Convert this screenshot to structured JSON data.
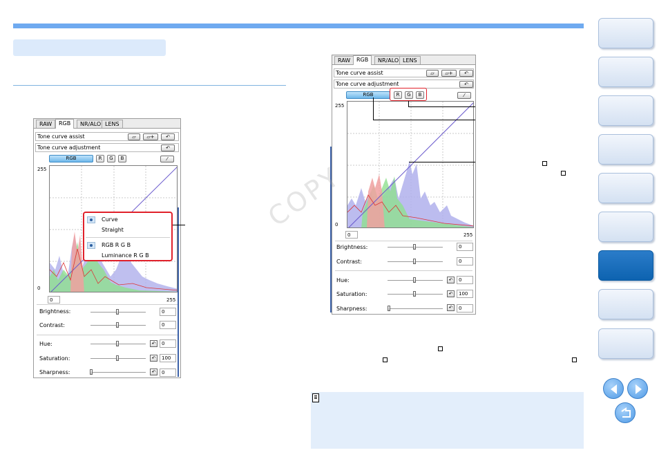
{
  "watermark": "COPY",
  "left_panel": {
    "tabs": [
      "RAW",
      "RGB",
      "NR/ALO",
      "LENS"
    ],
    "tone_curve_assist": "Tone curve assist",
    "tone_curve_adjustment": "Tone curve adjustment",
    "channels": [
      "RGB",
      "R",
      "G",
      "B"
    ],
    "axis_max": "255",
    "axis_min": "0",
    "input_min": "0",
    "input_max": "255",
    "sliders": [
      {
        "label": "Brightness:",
        "value": "0"
      },
      {
        "label": "Contrast:",
        "value": "0"
      },
      {
        "label": "Hue:",
        "value": "0"
      },
      {
        "label": "Saturation:",
        "value": "100"
      },
      {
        "label": "Sharpness:",
        "value": "0"
      }
    ],
    "menu": {
      "curve": "Curve",
      "straight": "Straight",
      "rgb": "RGB R G B",
      "luminance": "Luminance R G B"
    }
  },
  "right_panel": {
    "tabs": [
      "RAW",
      "RGB",
      "NR/ALO",
      "LENS"
    ],
    "tone_curve_assist": "Tone curve assist",
    "tone_curve_adjustment": "Tone curve adjustment",
    "channels": [
      "RGB",
      "R",
      "G",
      "B"
    ],
    "axis_max": "255",
    "axis_min": "0",
    "input_min": "0",
    "input_max": "255",
    "sliders": [
      {
        "label": "Brightness:",
        "value": "0"
      },
      {
        "label": "Contrast:",
        "value": "0"
      },
      {
        "label": "Hue:",
        "value": "0"
      },
      {
        "label": "Saturation:",
        "value": "100"
      },
      {
        "label": "Sharpness:",
        "value": "0"
      }
    ]
  },
  "colors": {
    "accent": "#6faaf0",
    "highlight": "#e0202a",
    "nav_active": "#0d63b0"
  }
}
